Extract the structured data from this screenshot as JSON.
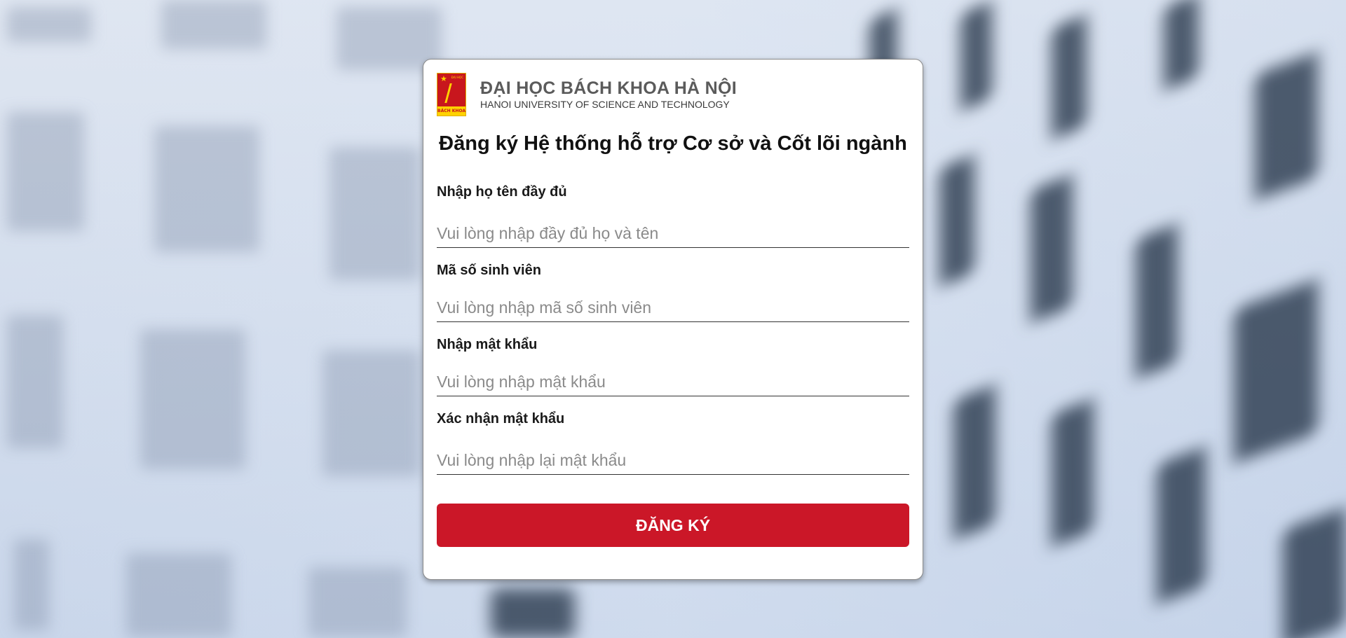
{
  "brand": {
    "logo_label": "BÁCH KHOA",
    "logo_small": "ĐẠI HỌC",
    "title": "ĐẠI HỌC BÁCH KHOA HÀ NỘI",
    "subtitle": "HANOI UNIVERSITY OF SCIENCE AND TECHNOLOGY"
  },
  "form": {
    "title": "Đăng ký Hệ thống hỗ trợ Cơ sở và Cốt lõi ngành",
    "fields": [
      {
        "label": "Nhập họ tên đầy đủ",
        "placeholder": "Vui lòng nhập đầy đủ họ và tên",
        "value": ""
      },
      {
        "label": "Mã số sinh viên",
        "placeholder": "Vui lòng nhập mã số sinh viên",
        "value": ""
      },
      {
        "label": "Nhập mật khẩu",
        "placeholder": "Vui lòng nhập mật khẩu",
        "value": ""
      },
      {
        "label": "Xác nhận mật khẩu",
        "placeholder": "Vui lòng nhập lại mật khẩu",
        "value": ""
      }
    ],
    "submit_label": "ĐĂNG KÝ"
  },
  "colors": {
    "accent": "#cb1728",
    "card_bg": "#ffffff",
    "brand_text": "#5b5b5b"
  }
}
